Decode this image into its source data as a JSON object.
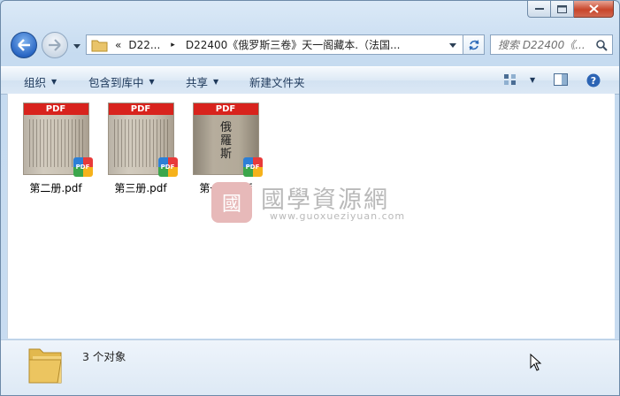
{
  "address": {
    "chevron_prefix": "«",
    "crumbs": [
      "D22...",
      "D22400《俄罗斯三卷》天一阁藏本.（法国..."
    ],
    "separator": "▸"
  },
  "search": {
    "placeholder": "搜索 D22400《..."
  },
  "toolbar": {
    "organize": "组织",
    "include_library": "包含到库中",
    "share": "共享",
    "new_folder": "新建文件夹"
  },
  "files": [
    {
      "name": "第二册.pdf",
      "band": "PDF",
      "badge": "PDF"
    },
    {
      "name": "第三册.pdf",
      "band": "PDF",
      "badge": "PDF"
    },
    {
      "name": "第一册.pdf",
      "band": "PDF",
      "badge": "PDF",
      "cover_title": "俄羅斯"
    }
  ],
  "watermark": {
    "seal": "國",
    "title": "國學資源網",
    "url": "www.guoxueziyuan.com"
  },
  "status": {
    "count_text": "3 个对象"
  },
  "colors": {
    "accent": "#2a67c4",
    "pdf_red": "#d8231d",
    "close": "#c8462b"
  }
}
